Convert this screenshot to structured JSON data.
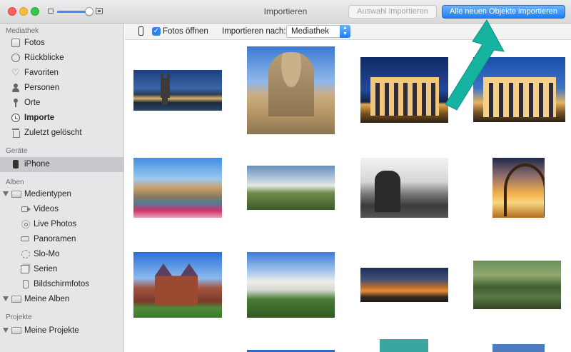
{
  "window": {
    "title": "Importieren",
    "buttons": {
      "import_selection": "Auswahl importieren",
      "import_all_new": "Alle neuen Objekte importieren"
    },
    "thumbnail_size_slider": {
      "value_fraction": 0.9
    }
  },
  "sidebar": {
    "sections": [
      {
        "header": "Mediathek",
        "items": [
          {
            "label": "Fotos",
            "icon": "photos-icon"
          },
          {
            "label": "Rückblicke",
            "icon": "memories-icon"
          },
          {
            "label": "Favoriten",
            "icon": "heart-icon"
          },
          {
            "label": "Personen",
            "icon": "person-icon"
          },
          {
            "label": "Orte",
            "icon": "pin-icon"
          },
          {
            "label": "Importe",
            "icon": "import-icon"
          },
          {
            "label": "Zuletzt gelöscht",
            "icon": "trash-icon"
          }
        ]
      },
      {
        "header": "Geräte",
        "items": [
          {
            "label": "iPhone",
            "icon": "iphone-icon",
            "selected": true
          }
        ]
      },
      {
        "header": "Alben",
        "items": [
          {
            "label": "Medientypen",
            "icon": "folder-icon",
            "expanded": true
          },
          {
            "label": "Videos",
            "icon": "video-icon"
          },
          {
            "label": "Live Photos",
            "icon": "live-photo-icon"
          },
          {
            "label": "Panoramen",
            "icon": "panorama-icon"
          },
          {
            "label": "Slo-Mo",
            "icon": "slomo-icon"
          },
          {
            "label": "Serien",
            "icon": "burst-icon"
          },
          {
            "label": "Bildschirmfotos",
            "icon": "screenshot-icon"
          },
          {
            "label": "Meine Alben",
            "icon": "folder-icon",
            "expanded": true
          }
        ]
      },
      {
        "header": "Projekte",
        "items": [
          {
            "label": "Meine Projekte",
            "icon": "folder-icon",
            "expanded": true
          }
        ]
      }
    ]
  },
  "toolbar": {
    "open_photos_label": "Fotos öffnen",
    "open_photos_checked": true,
    "import_to_label": "Importieren nach:",
    "import_to_value": "Mediathek"
  },
  "photos": [
    {
      "subject": "cologne-cathedral-panorama"
    },
    {
      "subject": "dresden-frauenkirche"
    },
    {
      "subject": "brandenburg-gate-night"
    },
    {
      "subject": "brandenburg-gate-evening"
    },
    {
      "subject": "bamberg-old-town-hall"
    },
    {
      "subject": "neuschwanstein-castle-valley"
    },
    {
      "subject": "bremen-town-musicians"
    },
    {
      "subject": "rollercoaster-sunset"
    },
    {
      "subject": "holstentor-luebeck"
    },
    {
      "subject": "neuschwanstein-castle"
    },
    {
      "subject": "cologne-bridge-night"
    },
    {
      "subject": "river-bridge-greenery"
    }
  ],
  "colors": {
    "accent": "#1f7ef3",
    "sidebar_bg": "#e6e6e9",
    "selected_row": "#c9c9cd",
    "annotation_arrow": "#16b3a0"
  }
}
